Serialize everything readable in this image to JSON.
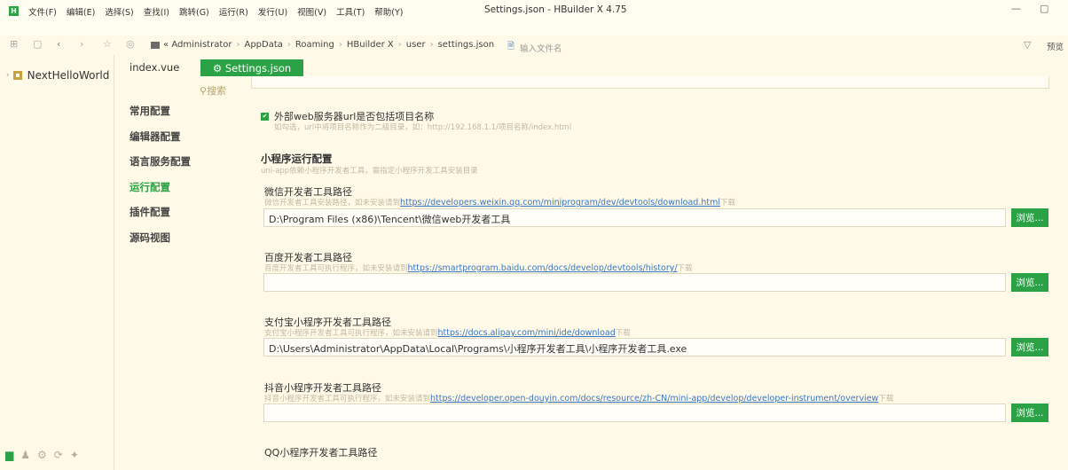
{
  "window": {
    "title": "Settings.json - HBuilder X 4.75",
    "logo_text": "H",
    "minimize": "—",
    "maximize": "▢"
  },
  "menu": [
    "文件(F)",
    "编辑(E)",
    "选择(S)",
    "查找(I)",
    "跳转(G)",
    "运行(R)",
    "发行(U)",
    "视图(V)",
    "工具(T)",
    "帮助(Y)"
  ],
  "toolbar": {
    "breadcrumb_prefix": "«",
    "breadcrumb": [
      "Administrator",
      "AppData",
      "Roaming",
      "HBuilder X",
      "user",
      "settings.json"
    ],
    "file_input_placeholder": "输入文件名",
    "preview_label": "预览"
  },
  "project": {
    "name": "NextHelloWorld"
  },
  "tabs": {
    "vue": "index.vue",
    "json": "Settings.json"
  },
  "settings_nav": {
    "search_label": "搜索",
    "items": [
      "常用配置",
      "编辑器配置",
      "语言服务配置",
      "运行配置",
      "插件配置",
      "源码视图"
    ],
    "active_index": 3
  },
  "content": {
    "checkbox_label": "外部web服务器url是否包括项目名称",
    "checkbox_hint": "如勾选，url中将项目名称作为二级目录，如：http://192.168.1.1/项目名称/index.html",
    "section_title": "小程序运行配置",
    "section_hint": "uni-app依赖小程序开发者工具，需指定小程序开发工具安装目录",
    "browse_label": "浏览...",
    "fields": [
      {
        "label": "微信开发者工具路径",
        "hint_before": "微信开发者工具安装路径，如未安装请到",
        "hint_link": "https://developers.weixin.qq.com/miniprogram/dev/devtools/download.html",
        "hint_after": "下载",
        "value": "D:\\Program Files (x86)\\Tencent\\微信web开发者工具"
      },
      {
        "label": "百度开发者工具路径",
        "hint_before": "百度开发者工具可执行程序，如未安装请到",
        "hint_link": "https://smartprogram.baidu.com/docs/develop/devtools/history/",
        "hint_after": "下载",
        "value": ""
      },
      {
        "label": "支付宝小程序开发者工具路径",
        "hint_before": "支付宝小程序开发者工具可执行程序，如未安装请到",
        "hint_link": "https://docs.alipay.com/mini/ide/download",
        "hint_after": "下载",
        "value": "D:\\Users\\Administrator\\AppData\\Local\\Programs\\小程序开发者工具\\小程序开发者工具.exe"
      },
      {
        "label": "抖音小程序开发者工具路径",
        "hint_before": "抖音小程序开发者工具可执行程序，如未安装请到",
        "hint_link": "https://developer.open-douyin.com/docs/resource/zh-CN/mini-app/develop/developer-instrument/overview",
        "hint_after": "下载",
        "value": ""
      },
      {
        "label": "QQ小程序开发者工具路径"
      }
    ]
  },
  "colors": {
    "accent": "#2ba245",
    "background": "#fffae8",
    "link": "#3b76c4",
    "hint": "#c2b99f"
  }
}
